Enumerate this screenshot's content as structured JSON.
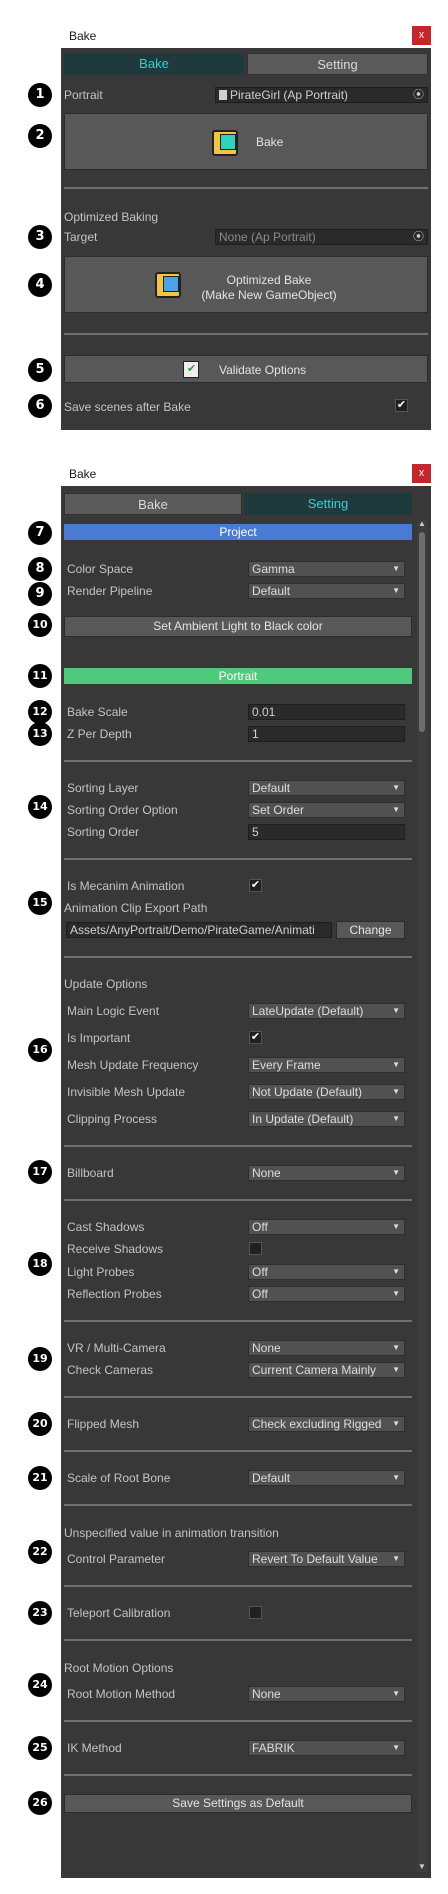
{
  "bake_window": {
    "title": "Bake",
    "close_label": "x",
    "tabs": [
      {
        "label": "Bake"
      },
      {
        "label": "Setting"
      }
    ],
    "portrait_label": "Portrait",
    "portrait_value": "PirateGirl (Ap Portrait)",
    "bake_button": "Bake",
    "optimized_baking_label": "Optimized Baking",
    "target_label": "Target",
    "target_value": "None (Ap Portrait)",
    "optimized_bake_line1": "Optimized Bake",
    "optimized_bake_line2": "(Make New GameObject)",
    "validate_button": "Validate Options",
    "save_scenes_label": "Save scenes after Bake",
    "save_scenes_checked": "✔"
  },
  "setting_window": {
    "title": "Bake",
    "close_label": "x",
    "tabs": [
      {
        "label": "Bake"
      },
      {
        "label": "Setting"
      }
    ],
    "project_header": "Project",
    "color_space_label": "Color Space",
    "color_space_value": "Gamma",
    "render_pipeline_label": "Render Pipeline",
    "render_pipeline_value": "Default",
    "ambient_button": "Set Ambient Light to Black color",
    "portrait_header": "Portrait",
    "bake_scale_label": "Bake Scale",
    "bake_scale_value": "0.01",
    "z_per_depth_label": "Z Per Depth",
    "z_per_depth_value": "1",
    "sorting_layer_label": "Sorting Layer",
    "sorting_layer_value": "Default",
    "sorting_order_option_label": "Sorting Order Option",
    "sorting_order_option_value": "Set Order",
    "sorting_order_label": "Sorting Order",
    "sorting_order_value": "5",
    "is_mecanim_label": "Is Mecanim Animation",
    "is_mecanim_checked": "✔",
    "clip_export_label": "Animation Clip Export Path",
    "clip_export_value": "Assets/AnyPortrait/Demo/PirateGame/Animati",
    "change_button": "Change",
    "update_options_label": "Update Options",
    "main_logic_label": "Main Logic Event",
    "main_logic_value": "LateUpdate (Default)",
    "is_important_label": "Is Important",
    "is_important_checked": "✔",
    "mesh_update_label": "Mesh Update Frequency",
    "mesh_update_value": "Every Frame",
    "invisible_mesh_label": "Invisible Mesh Update",
    "invisible_mesh_value": "Not Update (Default)",
    "clipping_label": "Clipping Process",
    "clipping_value": "In Update (Default)",
    "billboard_label": "Billboard",
    "billboard_value": "None",
    "cast_shadows_label": "Cast Shadows",
    "cast_shadows_value": "Off",
    "receive_shadows_label": "Receive Shadows",
    "light_probes_label": "Light Probes",
    "light_probes_value": "Off",
    "reflection_probes_label": "Reflection Probes",
    "reflection_probes_value": "Off",
    "vr_label": "VR / Multi-Camera",
    "vr_value": "None",
    "check_cameras_label": "Check Cameras",
    "check_cameras_value": "Current Camera Mainly",
    "flipped_mesh_label": "Flipped Mesh",
    "flipped_mesh_value": "Check excluding Rigged",
    "scale_root_label": "Scale of Root Bone",
    "scale_root_value": "Default",
    "unspecified_label": "Unspecified value in animation transition",
    "control_param_label": "Control Parameter",
    "control_param_value": "Revert To Default Value",
    "teleport_label": "Teleport Calibration",
    "root_motion_options_label": "Root Motion Options",
    "root_motion_method_label": "Root Motion Method",
    "root_motion_method_value": "None",
    "ik_method_label": "IK Method",
    "ik_method_value": "FABRIK",
    "save_default_button": "Save Settings as Default"
  },
  "markers": [
    "1",
    "2",
    "3",
    "4",
    "5",
    "6",
    "7",
    "8",
    "9",
    "10",
    "11",
    "12",
    "13",
    "14",
    "15",
    "16",
    "17",
    "18",
    "19",
    "20",
    "21",
    "22",
    "23",
    "24",
    "25",
    "26"
  ],
  "colors": {
    "panel_bg": "#383838",
    "tab_active_text": "#2fd2cf",
    "project_header": "#4a7bd4",
    "portrait_header": "#4fc97c",
    "close_button": "#c6262b"
  }
}
